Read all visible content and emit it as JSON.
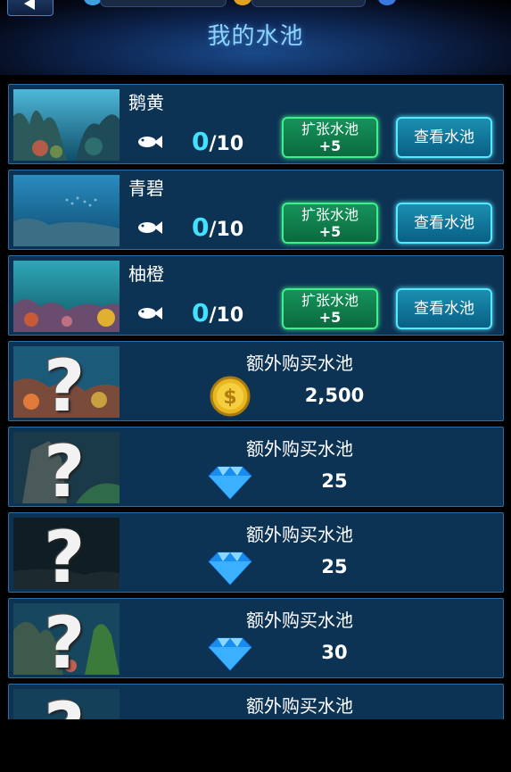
{
  "header": {
    "title": "我的水池",
    "back_icon": "back-arrow-icon"
  },
  "owned_pools": [
    {
      "name": "鹅黄",
      "current": "0",
      "capacity": "/10",
      "expand_label": "扩张水池",
      "expand_bonus": "+5",
      "view_label": "查看水池",
      "fish_icon": "fish-icon"
    },
    {
      "name": "青碧",
      "current": "0",
      "capacity": "/10",
      "expand_label": "扩张水池",
      "expand_bonus": "+5",
      "view_label": "查看水池",
      "fish_icon": "fish-icon"
    },
    {
      "name": "柚橙",
      "current": "0",
      "capacity": "/10",
      "expand_label": "扩张水池",
      "expand_bonus": "+5",
      "view_label": "查看水池",
      "fish_icon": "fish-icon"
    }
  ],
  "locked_pools": [
    {
      "title": "额外购买水池",
      "currency": "gold-coin-icon",
      "price": "2,500"
    },
    {
      "title": "额外购买水池",
      "currency": "diamond-icon",
      "price": "25"
    },
    {
      "title": "额外购买水池",
      "currency": "diamond-icon",
      "price": "25"
    },
    {
      "title": "额外购买水池",
      "currency": "diamond-icon",
      "price": "30"
    },
    {
      "title": "额外购买水池",
      "currency": "diamond-icon",
      "price": ""
    }
  ],
  "colors": {
    "card_bg": "#0d3354",
    "card_border": "#2a6fa0",
    "expand_button": "#15935a",
    "view_button": "#1a8fb0",
    "count_highlight": "#3fe3ff",
    "title": "#8fd4ff"
  }
}
